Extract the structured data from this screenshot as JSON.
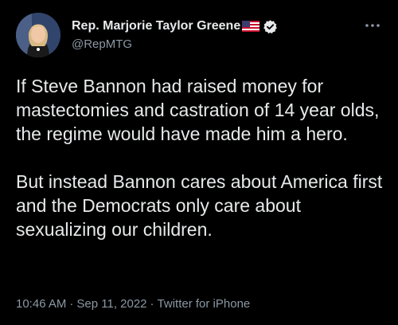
{
  "author": {
    "display_name": "Rep. Marjorie Taylor Greene",
    "handle": "@RepMTG",
    "flag_icon": "us-flag-icon",
    "verified_icon": "verified-badge-icon",
    "verified_color": "#e7e9ea"
  },
  "tweet": {
    "paragraphs": [
      "If Steve Bannon had raised money for mastectomies and castration of 14 year olds, the regime would have made him a hero.",
      "But instead Bannon cares about America first and the Democrats only care about sexualizing our children."
    ]
  },
  "meta": {
    "time": "10:46 AM",
    "separator": "·",
    "date": "Sep 11, 2022",
    "source": "Twitter for iPhone"
  },
  "colors": {
    "background": "#000000",
    "text": "#e7e9ea",
    "secondary": "#8b98a5"
  }
}
